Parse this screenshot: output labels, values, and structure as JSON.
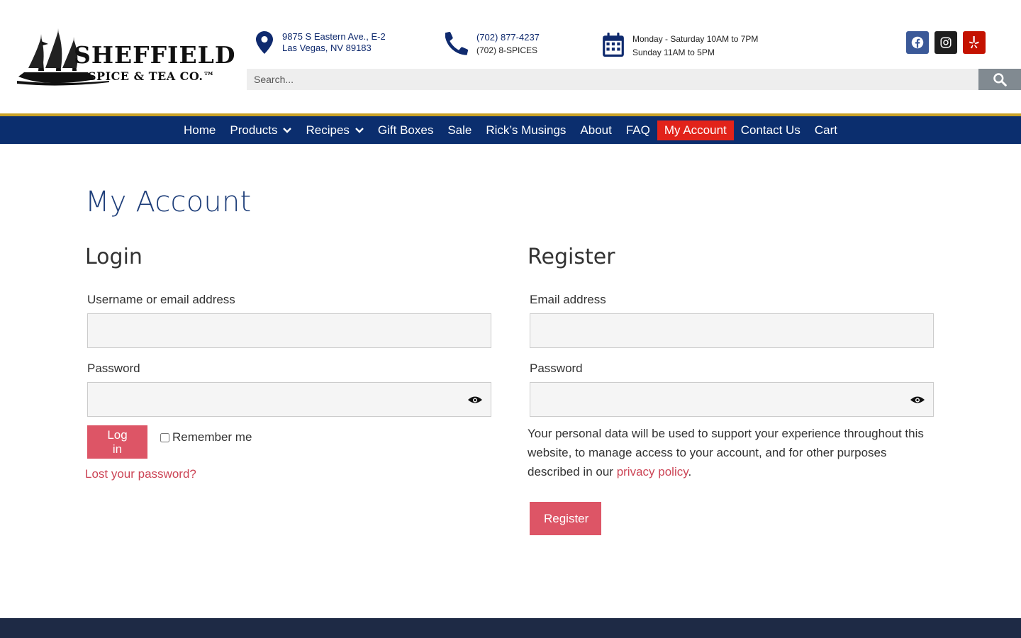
{
  "header": {
    "logo": {
      "line1": "SHEFFIELD",
      "line2": "SPICE & TEA CO.™"
    },
    "address": {
      "icon": "map-pin-icon",
      "line1": "9875 S Eastern Ave., E-2",
      "line2": "Las Vegas, NV 89183"
    },
    "phone": {
      "icon": "phone-icon",
      "line1": "(702) 877-4237",
      "line2": "(702) 8-SPICES"
    },
    "hours": {
      "icon": "calendar-icon",
      "line1": "Monday - Saturday 10AM to 7PM",
      "line2": "Sunday 11AM to 5PM"
    },
    "social": [
      {
        "name": "facebook-icon",
        "color": "#3b5998"
      },
      {
        "name": "instagram-icon",
        "color": "#1e1e1e"
      },
      {
        "name": "yelp-icon",
        "color": "#c41200"
      }
    ],
    "search": {
      "placeholder": "Search...",
      "icon": "search-icon"
    }
  },
  "nav": {
    "items": [
      {
        "label": "Home"
      },
      {
        "label": "Products",
        "has_dropdown": true
      },
      {
        "label": "Recipes",
        "has_dropdown": true
      },
      {
        "label": "Gift Boxes"
      },
      {
        "label": "Sale"
      },
      {
        "label": "Rick’s Musings"
      },
      {
        "label": "About"
      },
      {
        "label": "FAQ"
      },
      {
        "label": "My Account",
        "active": true
      },
      {
        "label": "Contact Us"
      },
      {
        "label": "Cart"
      }
    ],
    "background": "#0b2e6e",
    "active_color": "#e2231a"
  },
  "main": {
    "page_title": "My Account",
    "login": {
      "title": "Login",
      "username_label": "Username or email address",
      "username_value": "",
      "password_label": "Password",
      "password_value": "",
      "submit_label": "Log in",
      "remember_label": "Remember me",
      "remember_checked": false,
      "lost_password": "Lost your password?"
    },
    "register": {
      "title": "Register",
      "email_label": "Email address",
      "email_value": "",
      "password_label": "Password",
      "password_value": "",
      "privacy_text_before": "Your personal data will be used to support your experience throughout this website, to manage access to your account, and for other purposes described in our ",
      "privacy_link": "privacy policy",
      "privacy_text_after": ".",
      "submit_label": "Register"
    },
    "button_color": "#dd5566",
    "link_color": "#cc4455"
  }
}
